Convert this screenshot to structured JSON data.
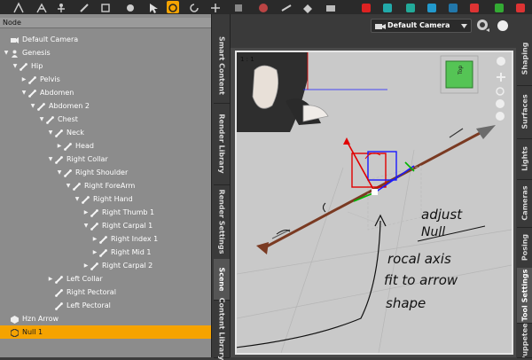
{
  "scene": {
    "column_header": "Node",
    "nodes": [
      {
        "label": "Default Camera",
        "depth": 0,
        "expander": "",
        "icon": "camera"
      },
      {
        "label": "Genesis",
        "depth": 0,
        "expander": "open",
        "icon": "figure"
      },
      {
        "label": "Hip",
        "depth": 1,
        "expander": "open",
        "icon": "bone"
      },
      {
        "label": "Pelvis",
        "depth": 2,
        "expander": "closed",
        "icon": "bone"
      },
      {
        "label": "Abdomen",
        "depth": 2,
        "expander": "open",
        "icon": "bone"
      },
      {
        "label": "Abdomen 2",
        "depth": 3,
        "expander": "open",
        "icon": "bone"
      },
      {
        "label": "Chest",
        "depth": 4,
        "expander": "open",
        "icon": "bone"
      },
      {
        "label": "Neck",
        "depth": 5,
        "expander": "open",
        "icon": "bone"
      },
      {
        "label": "Head",
        "depth": 6,
        "expander": "closed",
        "icon": "bone"
      },
      {
        "label": "Right Collar",
        "depth": 5,
        "expander": "open",
        "icon": "bone"
      },
      {
        "label": "Right Shoulder",
        "depth": 6,
        "expander": "open",
        "icon": "bone"
      },
      {
        "label": "Right ForeArm",
        "depth": 7,
        "expander": "open",
        "icon": "bone"
      },
      {
        "label": "Right Hand",
        "depth": 8,
        "expander": "open",
        "icon": "bone"
      },
      {
        "label": "Right Thumb 1",
        "depth": 9,
        "expander": "closed",
        "icon": "bone"
      },
      {
        "label": "Right Carpal 1",
        "depth": 9,
        "expander": "open",
        "icon": "bone"
      },
      {
        "label": "Right Index 1",
        "depth": 10,
        "expander": "closed",
        "icon": "bone"
      },
      {
        "label": "Right Mid 1",
        "depth": 10,
        "expander": "closed",
        "icon": "bone"
      },
      {
        "label": "Right Carpal 2",
        "depth": 9,
        "expander": "closed",
        "icon": "bone"
      },
      {
        "label": "Left Collar",
        "depth": 5,
        "expander": "closed",
        "icon": "bone"
      },
      {
        "label": "Right Pectoral",
        "depth": 5,
        "expander": "",
        "icon": "bone"
      },
      {
        "label": "Left Pectoral",
        "depth": 5,
        "expander": "",
        "icon": "bone"
      },
      {
        "label": "Hzn Arrow",
        "depth": 0,
        "expander": "",
        "icon": "prop"
      },
      {
        "label": "Null 1",
        "depth": 0,
        "expander": "",
        "icon": "null",
        "selected": true
      }
    ]
  },
  "left_tabs": [
    "Smart Content",
    "Render Library",
    "Render Settings",
    "Scene",
    "Content Library"
  ],
  "active_left_tab": "Scene",
  "right_tabs": [
    "Shaping",
    "Surfaces",
    "Lights",
    "Cameras",
    "Posing",
    "Tool Settings",
    "Puppeteer"
  ],
  "active_right_tab": "Tool Settings",
  "viewport": {
    "camera": "Default Camera",
    "layout_label": "1 : 1",
    "view_cube_label": "Top"
  },
  "annotation": {
    "lines": [
      "adjust",
      "Null",
      "rocal axis",
      "fit to arrow",
      "shape"
    ]
  },
  "colors": {
    "selection": "#f5a300",
    "panel": "#8c8c8c",
    "viewport": "#c9c9c9",
    "x_axis": "#e00000",
    "y_axis": "#00b400",
    "z_axis": "#1a1aff",
    "arrow_shaft": "#7a3a22"
  }
}
